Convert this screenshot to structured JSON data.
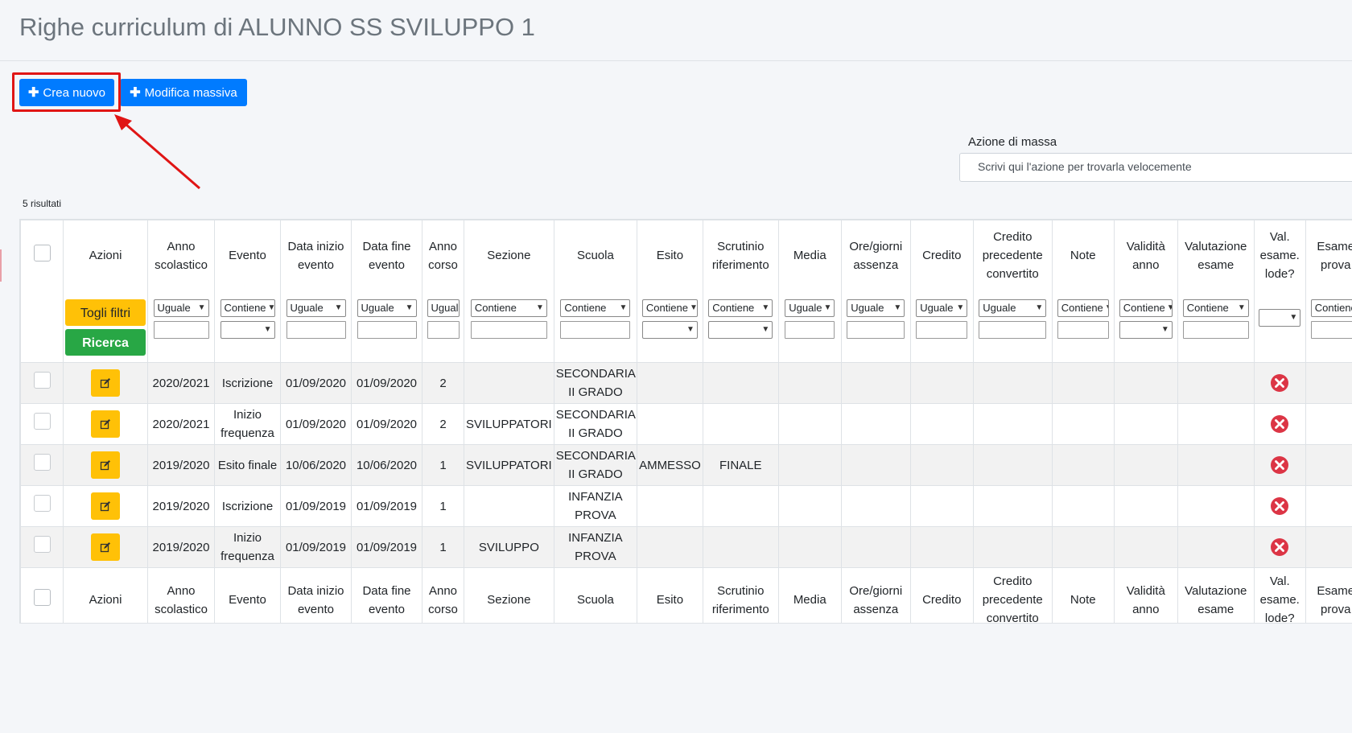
{
  "page": {
    "title": "Righe curriculum di ALUNNO SS SVILUPPO 1"
  },
  "toolbar": {
    "create_label": "Crea nuovo",
    "bulk_edit_label": "Modifica massiva",
    "plus_icon": "plus-icon"
  },
  "mass_action": {
    "label": "Azione di massa",
    "placeholder": "Scrivi qui l'azione per trovarla velocemente"
  },
  "results_count": "5 risultati",
  "columns": [
    "Azioni",
    "Anno scolastico",
    "Evento",
    "Data inizio evento",
    "Data fine evento",
    "Anno corso",
    "Sezione",
    "Scuola",
    "Esito",
    "Scrutinio riferimento",
    "Media",
    "Ore/giorni assenza",
    "Credito",
    "Credito precedente convertito",
    "Note",
    "Validità anno",
    "Valutazione esame",
    "Val. esame. lode?",
    "Esame prova"
  ],
  "filters": {
    "clear_label": "Togli filtri",
    "search_label": "Ricerca",
    "operators": [
      "Uguale",
      "Contiene",
      "Uguale",
      "Uguale",
      "Uguale",
      "Contiene",
      "Contiene",
      "Contiene",
      "Contiene",
      "Uguale",
      "Uguale",
      "Uguale",
      "Uguale",
      "Contiene",
      "Contiene",
      "Contiene",
      "",
      "Contiene"
    ]
  },
  "rows": [
    {
      "anno": "2020/2021",
      "evento": "Iscrizione",
      "inizio": "01/09/2020",
      "fine": "01/09/2020",
      "corso": "2",
      "sezione": "",
      "scuola": "SECONDARIA II GRADO",
      "esito": "",
      "scrutinio": ""
    },
    {
      "anno": "2020/2021",
      "evento": "Inizio frequenza",
      "inizio": "01/09/2020",
      "fine": "01/09/2020",
      "corso": "2",
      "sezione": "SVILUPPATORI",
      "scuola": "SECONDARIA II GRADO",
      "esito": "",
      "scrutinio": ""
    },
    {
      "anno": "2019/2020",
      "evento": "Esito finale",
      "inizio": "10/06/2020",
      "fine": "10/06/2020",
      "corso": "1",
      "sezione": "SVILUPPATORI",
      "scuola": "SECONDARIA II GRADO",
      "esito": "AMMESSO",
      "scrutinio": "FINALE"
    },
    {
      "anno": "2019/2020",
      "evento": "Iscrizione",
      "inizio": "01/09/2019",
      "fine": "01/09/2019",
      "corso": "1",
      "sezione": "",
      "scuola": "INFANZIA PROVA",
      "esito": "",
      "scrutinio": ""
    },
    {
      "anno": "2019/2020",
      "evento": "Inizio frequenza",
      "inizio": "01/09/2019",
      "fine": "01/09/2019",
      "corso": "1",
      "sezione": "SVILUPPO",
      "scuola": "INFANZIA PROVA",
      "esito": "",
      "scrutinio": ""
    }
  ],
  "icons": {
    "edit": "edit-icon",
    "lode_false": "x-circle-icon",
    "annotation": "red-arrow-annotation"
  },
  "colors": {
    "primary": "#007bff",
    "warning": "#ffc107",
    "success": "#28a745",
    "danger": "#dc3545",
    "highlight": "#e01515"
  }
}
